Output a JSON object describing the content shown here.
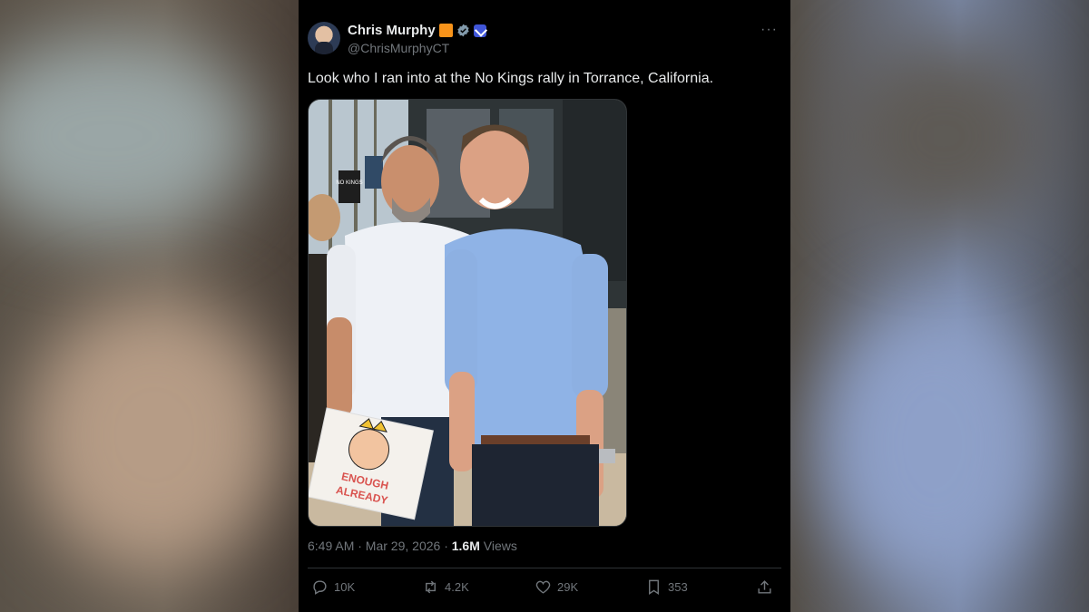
{
  "tweet": {
    "author_name": "Chris Murphy",
    "handle": "@ChrisMurphyCT",
    "text": "Look who I ran into at the No Kings rally in Torrance, California.",
    "timestamp": "6:49 AM · Mar 29, 2026 · ",
    "views_count": "1.6M",
    "views_label": "Views",
    "more_icon": "···"
  },
  "photo": {
    "sign_text_line1": "ENOUGH",
    "sign_text_line2": "ALREADY",
    "background_sign_text": "NO KINGS"
  },
  "actions": {
    "replies": "10K",
    "reposts": "4.2K",
    "likes": "29K",
    "bookmarks": "353"
  },
  "icons": [
    "reply-icon",
    "repost-icon",
    "like-icon",
    "bookmark-icon",
    "share-icon",
    "verified-icon",
    "more-icon"
  ],
  "colors": {
    "background": "#000000",
    "text": "#e7e9ea",
    "muted": "#71767b",
    "verified": "#829aab",
    "affiliation": "#4056d8",
    "badge": "#f7931a"
  }
}
